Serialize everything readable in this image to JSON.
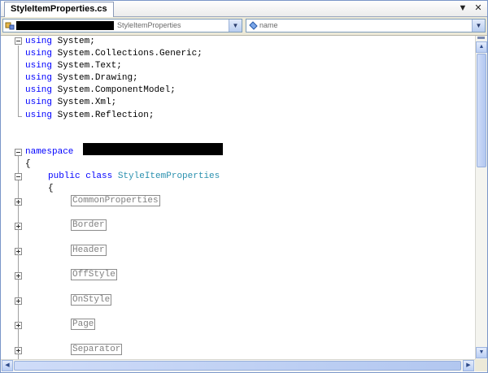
{
  "tab": {
    "title": "StyleItemProperties.cs"
  },
  "tab_controls": {
    "dropdown_glyph": "▼",
    "close_glyph": "✕"
  },
  "navbar": {
    "type_combo": {
      "value": "StyleItemProperties",
      "icon": "class-icon",
      "arrow": "▼"
    },
    "member_combo": {
      "value": "name",
      "icon": "field-icon",
      "arrow": "▼"
    }
  },
  "code": {
    "using_kw": "using",
    "usings": [
      "System;",
      "System.Collections.Generic;",
      "System.Text;",
      "System.Drawing;",
      "System.ComponentModel;",
      "System.Xml;",
      "System.Reflection;"
    ],
    "namespace_kw": "namespace",
    "brace_open": "{",
    "class_modifiers": "public class",
    "class_name": "StyleItemProperties",
    "regions": [
      "CommonProperties",
      "Border",
      "Header",
      "OffStyle",
      "OnStyle",
      "Page",
      "Separator"
    ]
  },
  "scrollbars": {
    "up": "▲",
    "down": "▼",
    "left": "◀",
    "right": "▶"
  },
  "colors": {
    "keyword": "#0000ff",
    "type": "#2b91af",
    "collapsed_text": "#808080",
    "redaction": "#000000"
  }
}
